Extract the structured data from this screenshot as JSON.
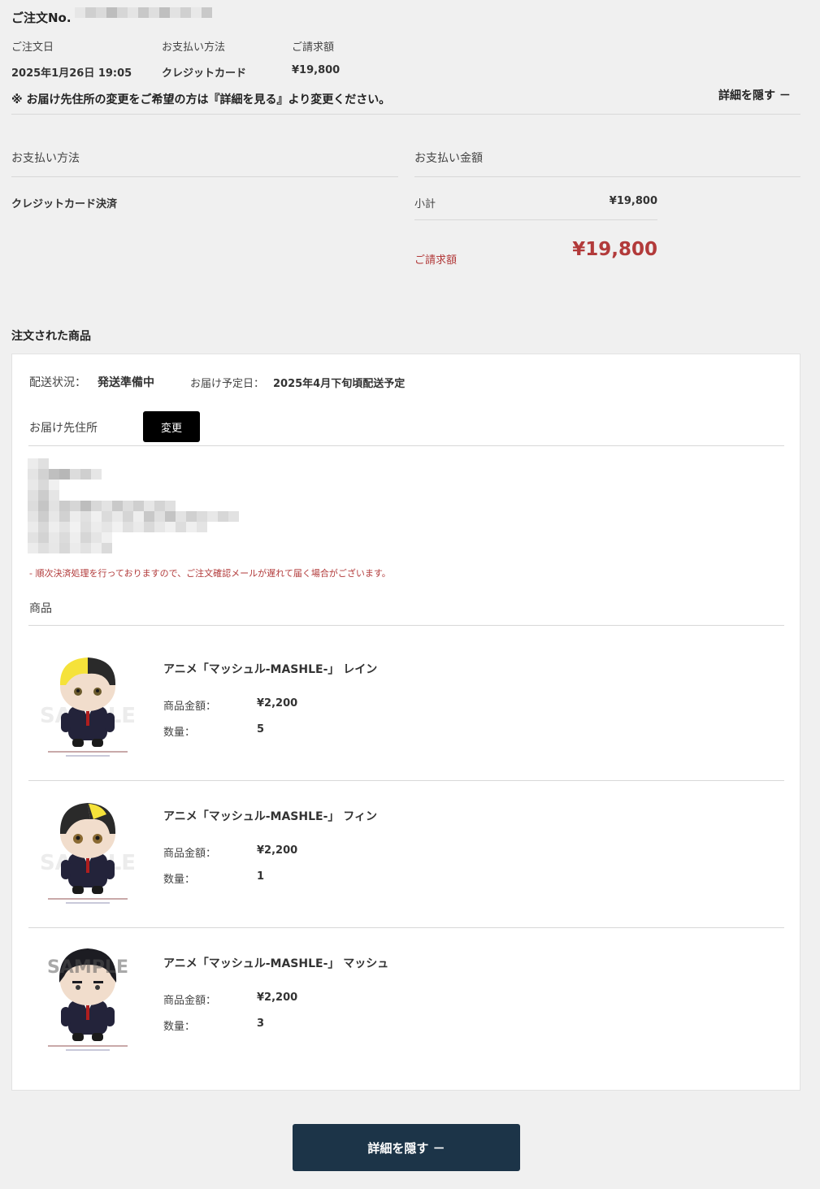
{
  "header": {
    "order_no_label": "ご注文No.",
    "order_date_label": "ご注文日",
    "payment_method_label": "お支払い方法",
    "billed_amount_label": "ご請求額",
    "order_date": "2025年1月26日 19:05",
    "payment_method": "クレジットカード",
    "billed_amount": "¥19,800",
    "notice": "※ お届け先住所の変更をご希望の方は『詳細を見る』より変更ください。",
    "hide_details": "詳細を隠す －"
  },
  "payment": {
    "method_heading": "お支払い方法",
    "amount_heading": "お支払い金額",
    "method_value": "クレジットカード決済",
    "subtotal_label": "小計",
    "subtotal_value": "¥19,800",
    "billed_label": "ご請求額",
    "billed_value": "¥19,800"
  },
  "items_section": {
    "title": "注文された商品",
    "shipping_status_label": "配送状況：",
    "shipping_status": "発送準備中",
    "eta_label": "お届け予定日：",
    "eta_value": "2025年4月下旬頃配送予定",
    "address_label": "お届け先住所",
    "change_button": "変更",
    "note": "- 順次決済処理を行っておりますので、ご注文確認メールが遅れて届く場合がございます。",
    "products_label": "商品",
    "price_label": "商品金額：",
    "qty_label": "数量：",
    "products": [
      {
        "name": "アニメ「マッシュル-MASHLE-」 レイン",
        "price": "¥2,200",
        "qty": "5"
      },
      {
        "name": "アニメ「マッシュル-MASHLE-」 フィン",
        "price": "¥2,200",
        "qty": "1"
      },
      {
        "name": "アニメ「マッシュル-MASHLE-」 マッシュ",
        "price": "¥2,200",
        "qty": "3"
      }
    ]
  },
  "footer": {
    "hide_details_button": "詳細を隠す －"
  },
  "colors": {
    "accent_red": "#b23a3a",
    "button_navy": "#1c3448"
  }
}
